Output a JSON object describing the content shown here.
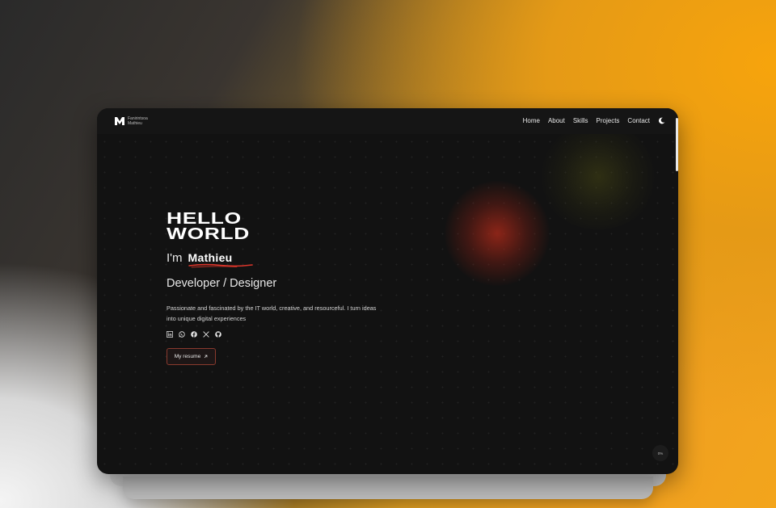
{
  "header": {
    "logo_line1": "Fanirintsoa",
    "logo_line2": "Mathieu",
    "nav": [
      "Home",
      "About",
      "Skills",
      "Projects",
      "Contact"
    ],
    "theme_icon": "moon-icon"
  },
  "hero": {
    "hello_line1": "HELLO",
    "hello_line2": "WORLD",
    "im": "I'm",
    "name": "Mathieu",
    "role": "Developer / Designer",
    "description": "Passionate and fascinated by the IT world, creative, and resourceful. I turn ideas into unique digital experiences",
    "socials": [
      "linkedin-icon",
      "whatsapp-icon",
      "facebook-icon",
      "x-icon",
      "github-icon"
    ],
    "resume_label": "My resume",
    "resume_icon": "arrow-up-right-icon"
  },
  "scroll_progress": "0%",
  "colors": {
    "accent": "#d8352a",
    "background": "#121212"
  }
}
